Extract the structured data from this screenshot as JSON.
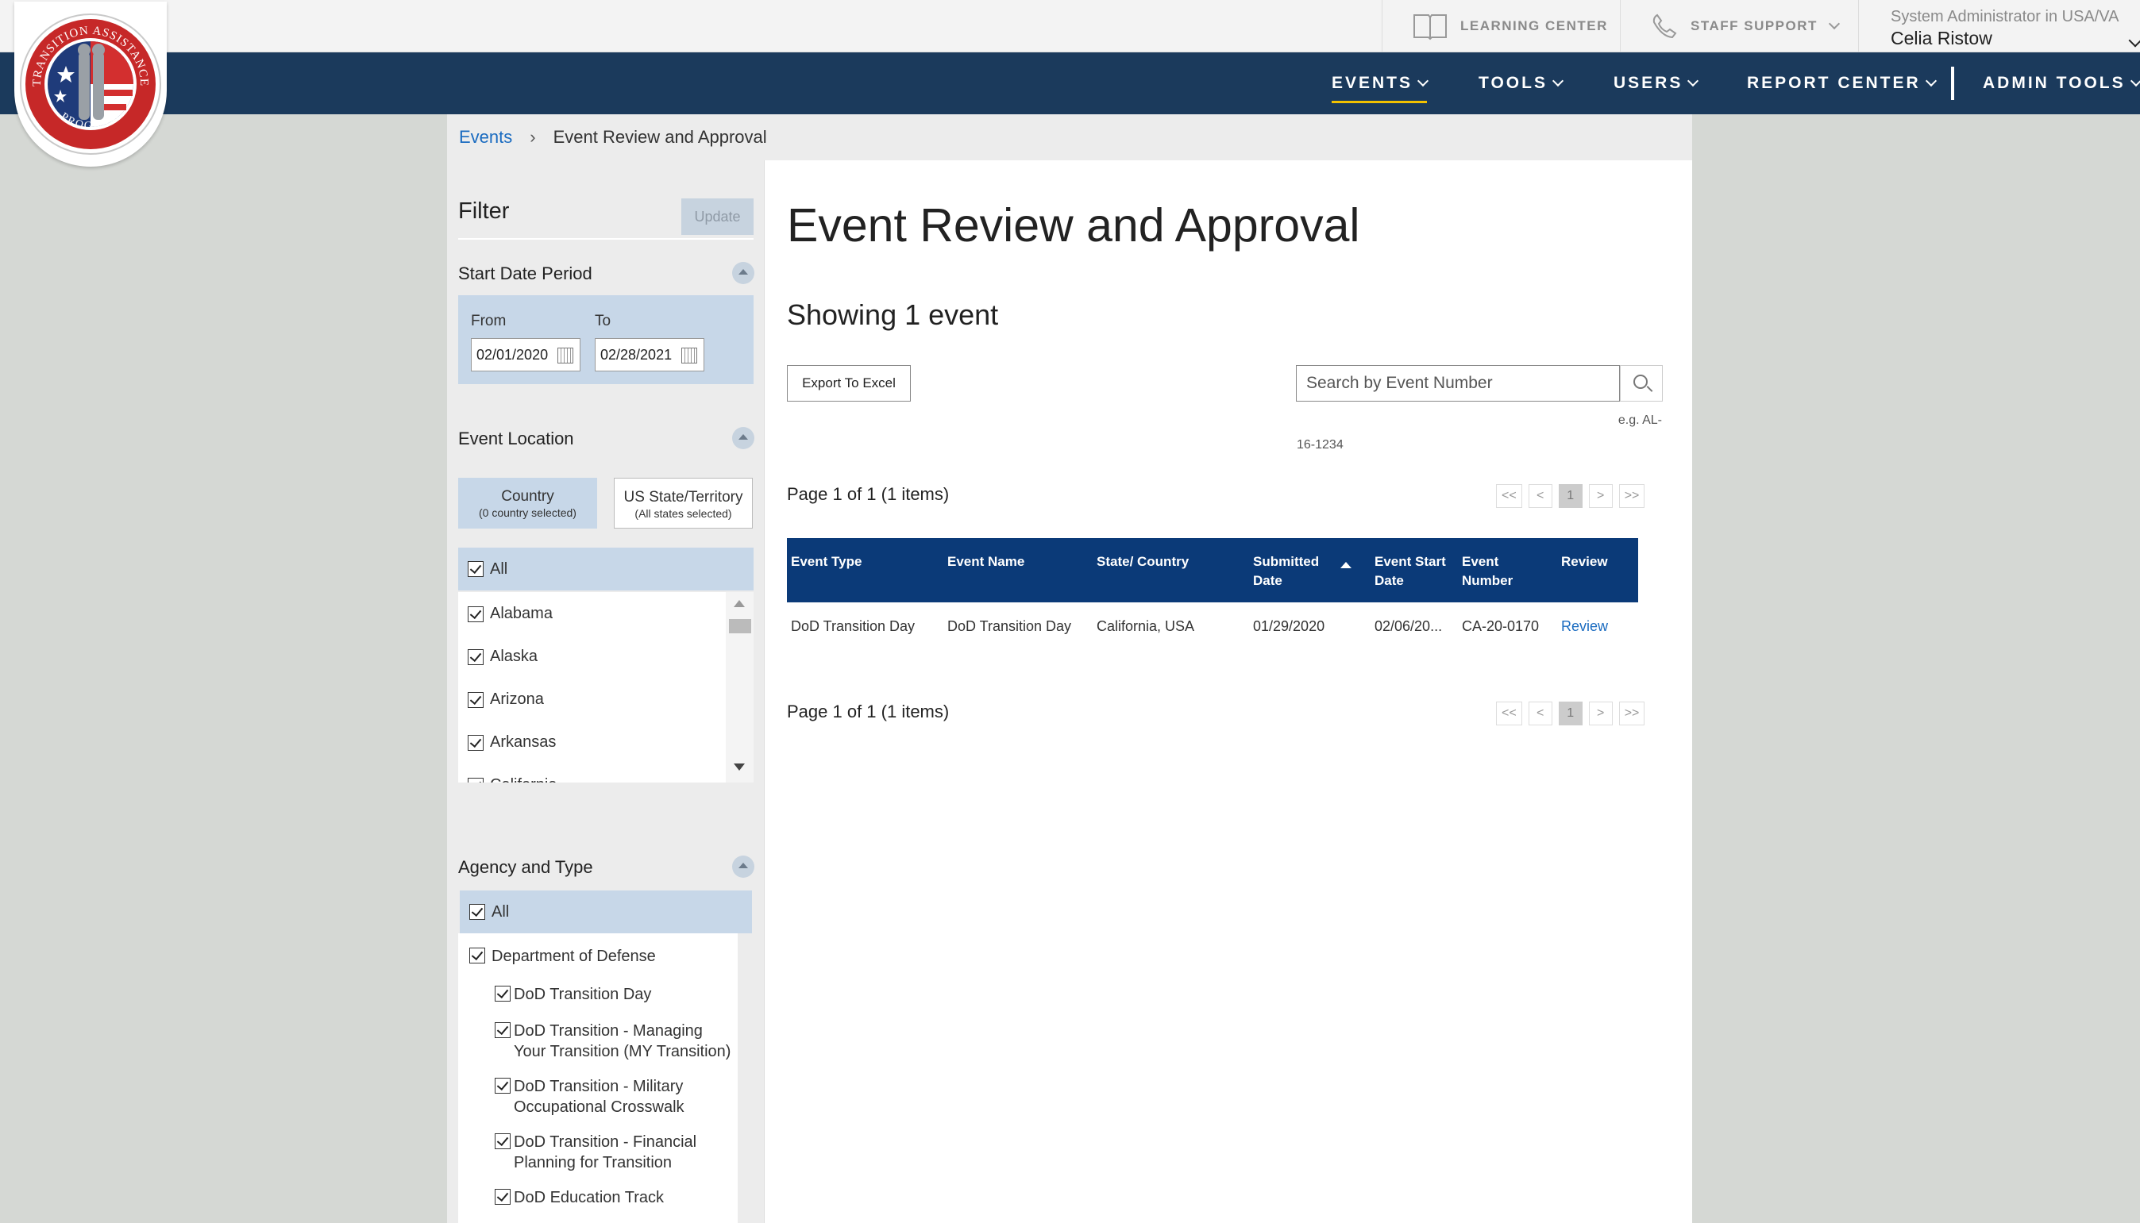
{
  "topbar": {
    "learning_center": "LEARNING CENTER",
    "staff_support": "STAFF SUPPORT",
    "user_role": "System Administrator in USA/VA",
    "user_name": "Celia Ristow"
  },
  "nav": {
    "events": "EVENTS",
    "tools": "TOOLS",
    "users": "USERS",
    "report_center": "REPORT CENTER",
    "admin_tools": "ADMIN TOOLS"
  },
  "logo": {
    "top_text": "TRANSITION ASSISTANCE",
    "bottom_text": "PROGRAM"
  },
  "breadcrumb": {
    "parent": "Events",
    "separator": "›",
    "current": "Event Review and Approval"
  },
  "filter": {
    "title": "Filter",
    "update_label": "Update",
    "start_date": {
      "title": "Start Date Period",
      "from_label": "From",
      "to_label": "To",
      "from_value": "02/01/2020",
      "to_value": "02/28/2021"
    },
    "location": {
      "title": "Event Location",
      "tab_country": "Country",
      "tab_country_sub": "(0 country selected)",
      "tab_state": "US State/Territory",
      "tab_state_sub": "(All states selected)",
      "all_label": "All",
      "states": [
        "Alabama",
        "Alaska",
        "Arizona",
        "Arkansas",
        "California"
      ]
    },
    "agency": {
      "title": "Agency and Type",
      "all_label": "All",
      "department": "Department of Defense",
      "types": [
        "DoD Transition Day",
        "DoD Transition - Managing Your Transition (MY Transition)",
        "DoD Transition - Military Occupational Crosswalk",
        "DoD Transition - Financial Planning for Transition",
        "DoD Education Track"
      ]
    }
  },
  "main": {
    "title": "Event Review and Approval",
    "showing": "Showing 1 event",
    "export_label": "Export To Excel",
    "search_placeholder": "Search by Event Number",
    "search_hint_1": "e.g. AL-",
    "search_hint_2": "16-1234",
    "pager_text": "Page 1  of 1 (1 items)",
    "pager": {
      "first": "<<",
      "prev": "<",
      "current": "1",
      "next": ">",
      "last": ">>"
    },
    "columns": [
      "Event Type",
      "Event Name",
      "State/ Country",
      "Submitted Date",
      "Event Start Date",
      "Event Number",
      "Review"
    ],
    "rows": [
      {
        "event_type": "DoD Transition Day",
        "event_name": "DoD Transition Day",
        "state_country": "California, USA",
        "submitted": "01/29/2020",
        "start_date": "02/06/20...",
        "event_number": "CA-20-0170",
        "review": "Review"
      }
    ]
  }
}
